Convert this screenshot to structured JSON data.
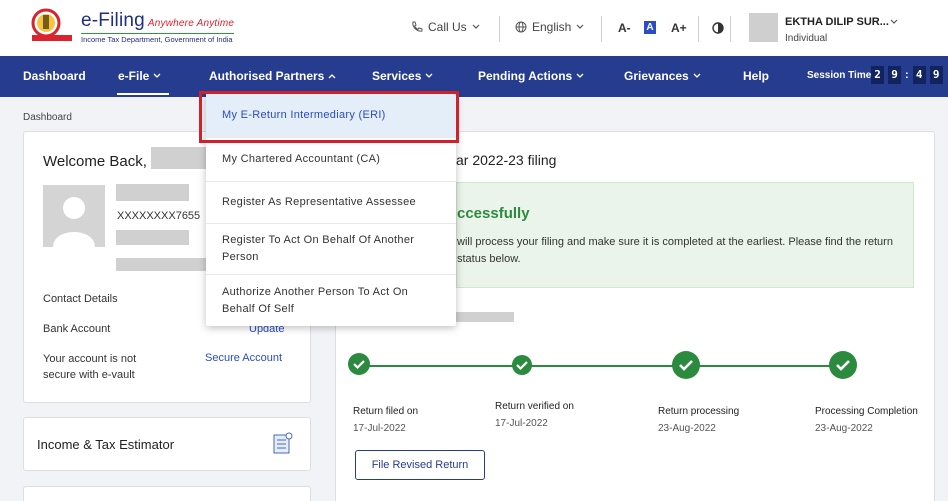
{
  "header": {
    "brand_title": "e-Filing",
    "brand_tagline": "Anywhere Anytime",
    "brand_subtitle": "Income Tax Department, Government of India",
    "call_us": "Call Us",
    "language": "English",
    "font_decrease": "A-",
    "font_normal": "A",
    "font_increase": "A+",
    "user_name": "EKTHA DILIP SUR...",
    "user_role": "Individual"
  },
  "nav": {
    "items": [
      "Dashboard",
      "e-File",
      "Authorised Partners",
      "Services",
      "Pending Actions",
      "Grievances",
      "Help"
    ],
    "session_label": "Session Time",
    "session_digits": [
      "2",
      "9",
      "4",
      "9"
    ]
  },
  "dropdown": {
    "items": [
      "My E-Return Intermediary (ERI)",
      "My Chartered Accountant (CA)",
      "Register As Representative Assessee",
      "Register To Act On Behalf Of Another Person",
      "Authorize Another Person To Act On Behalf Of Self"
    ]
  },
  "breadcrumb": "Dashboard",
  "profile": {
    "welcome": "Welcome Back,",
    "pan_masked": "XXXXXXXX7655",
    "contact_label": "Contact Details",
    "bank_label": "Bank Account",
    "bank_link": "Update",
    "secure_msg": "Your account is not secure with e-vault",
    "secure_link": "Secure Account"
  },
  "estimator": {
    "title": "Income & Tax Estimator"
  },
  "filing": {
    "title": "ar 2022-23 filing",
    "success_heading": "ccessfully",
    "success_text": "will process your filing and make sure it is completed at the earliest. Please find the return status below.",
    "steps": [
      {
        "label": "Return filed on",
        "date": "17-Jul-2022"
      },
      {
        "label": "Return verified on",
        "date": "17-Jul-2022"
      },
      {
        "label": "Return processing",
        "date": "23-Aug-2022"
      },
      {
        "label": "Processing Completion",
        "date": "23-Aug-2022"
      }
    ],
    "revised_button": "File Revised Return"
  },
  "colors": {
    "nav_bg": "#263c8f",
    "accent": "#2b4cc4",
    "success": "#2b8a3e",
    "highlight_border": "#d0202a"
  }
}
